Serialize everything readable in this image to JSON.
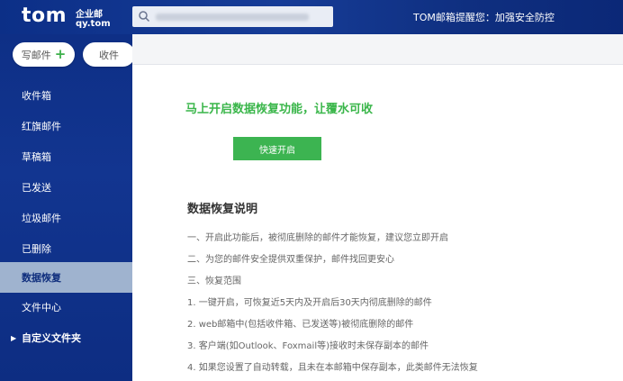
{
  "header": {
    "logo_main": "tom",
    "logo_line1": "企业邮",
    "logo_line2": "qy.tom",
    "search_value": "",
    "notice": "TOM邮箱提醒您：加强安全防控"
  },
  "sidebar": {
    "compose_label": "写邮件",
    "receive_label": "收件",
    "items": [
      {
        "label": "收件箱"
      },
      {
        "label": "红旗邮件"
      },
      {
        "label": "草稿箱"
      },
      {
        "label": "已发送"
      },
      {
        "label": "垃圾邮件"
      },
      {
        "label": "已删除"
      },
      {
        "label": "数据恢复"
      },
      {
        "label": "文件中心"
      },
      {
        "label": "自定义文件夹"
      }
    ],
    "active_item": "数据恢复"
  },
  "main": {
    "headline": "马上开启数据恢复功能，让覆水可收",
    "enable_button": "快速开启",
    "section_title": "数据恢复说明",
    "lines": [
      "一、开启此功能后，被彻底删除的邮件才能恢复，建议您立即开启",
      "二、为您的邮件安全提供双重保护，邮件找回更安心",
      "三、恢复范围",
      "1. 一键开启，可恢复近5天内及开启后30天内彻底删除的邮件",
      "2. web邮箱中(包括收件箱、已发送等)被彻底删除的邮件",
      "3. 客户端(如Outlook、Foxmail等)接收时未保存副本的邮件",
      "4. 如果您设置了自动转载，且未在本邮箱中保存副本，此类邮件无法恢复"
    ]
  },
  "colors": {
    "brand_blue": "#0e2f86",
    "accent_green": "#3cb451",
    "active_nav": "#9fb3cf"
  },
  "icons": {
    "search": "search-icon",
    "compose_plus": "plus-icon",
    "folder_toggle": "caret-right-icon"
  }
}
